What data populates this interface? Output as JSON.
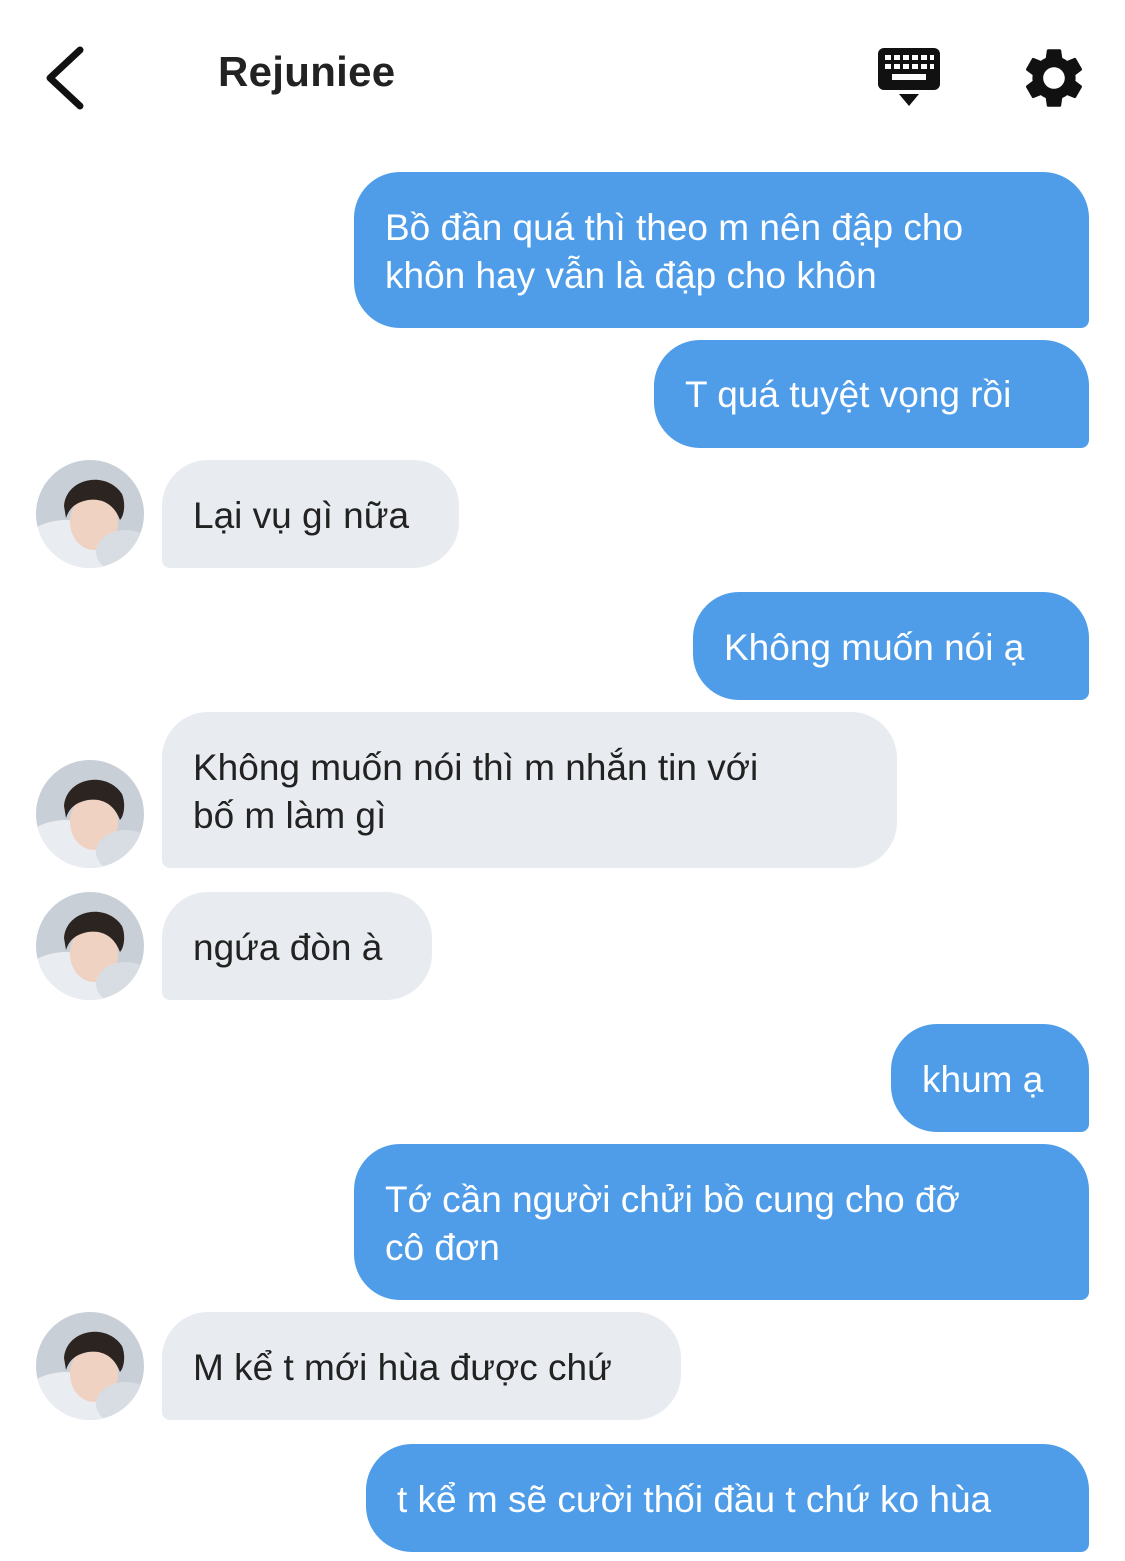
{
  "header": {
    "title": "Rejuniee",
    "back_icon": "chevron-left-icon",
    "keyboard_icon": "keyboard-icon",
    "settings_icon": "gear-icon"
  },
  "colors": {
    "outgoing_bubble": "#4f9de8",
    "incoming_bubble": "#e8ebef",
    "outgoing_text": "#ffffff",
    "incoming_text": "#222222",
    "icon": "#111111"
  },
  "messages": [
    {
      "direction": "outgoing",
      "text": "Bồ đần quá thì theo m nên đập cho\nkhôn hay vẫn là đập cho khôn"
    },
    {
      "direction": "outgoing",
      "text": "T quá tuyệt vọng rồi"
    },
    {
      "direction": "incoming",
      "text": "Lại vụ gì nữa"
    },
    {
      "direction": "outgoing",
      "text": "Không muốn nói ạ"
    },
    {
      "direction": "incoming",
      "text": "Không muốn nói thì m nhắn tin với\nbố m làm gì"
    },
    {
      "direction": "incoming",
      "text": "ngứa đòn à"
    },
    {
      "direction": "outgoing",
      "text": "khum ạ"
    },
    {
      "direction": "outgoing",
      "text": "Tớ cần người chửi bồ cung cho đỡ\ncô đơn"
    },
    {
      "direction": "incoming",
      "text": "M kể t mới hùa được chứ"
    },
    {
      "direction": "outgoing",
      "text": "t kể m sẽ cười thối đầu t chứ ko hùa"
    }
  ]
}
